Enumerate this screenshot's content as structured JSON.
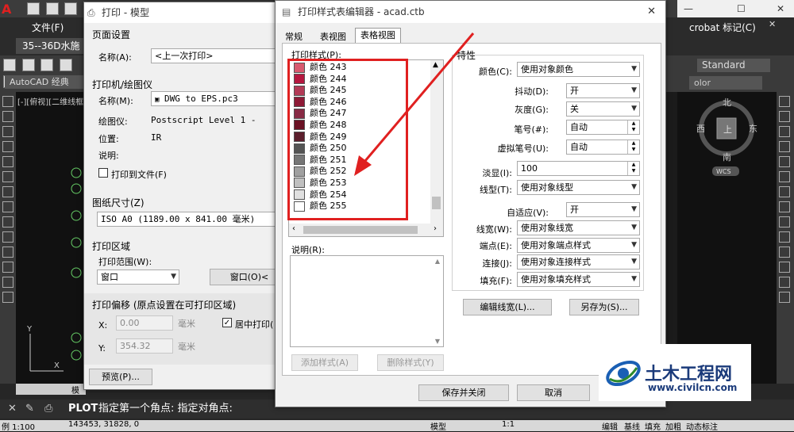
{
  "cad": {
    "tabs": {
      "file": "文件(F)",
      "drawing": "35--36D水施",
      "acrobat": "crobat 标记(C)"
    },
    "workspace": "AutoCAD 经典",
    "style_combo": "Standard",
    "color_combo": "olor",
    "viewport_label": "[-][俯视][二维线框",
    "compass": {
      "north": "北",
      "south": "南",
      "west": "西",
      "east": "东",
      "center": "上",
      "wcs": "WCS"
    },
    "command": {
      "prompt_label": "PLOT",
      "prompt_text": "指定第一个角点: 指定对角点:"
    },
    "status": {
      "scale": "例 1:100",
      "coords": "143453, 31828, 0",
      "model": "模型",
      "ratio": "1:1",
      "edit": "编辑",
      "baseline": "基线",
      "fill": "填充",
      "bold": "加粗",
      "dyn": "动态标注"
    },
    "model_tab": "模"
  },
  "plot_dialog": {
    "title": "打印 - 模型",
    "page_setup": {
      "heading": "页面设置",
      "name_label": "名称(A):",
      "name_value": "<上一次打印>"
    },
    "printer": {
      "heading": "打印机/绘图仪",
      "name_label": "名称(M):",
      "name_value": "DWG to EPS.pc3",
      "plotter_label": "绘图仪:",
      "plotter_value": "Postscript Level 1 -",
      "location_label": "位置:",
      "location_value": "IR",
      "desc_label": "说明:",
      "print_to_file": "打印到文件(F)"
    },
    "paper": {
      "heading": "图纸尺寸(Z)",
      "value": "ISO A0 (1189.00 x 841.00 毫米)"
    },
    "area": {
      "heading": "打印区域",
      "range_label": "打印范围(W):",
      "range_value": "窗口",
      "window_button": "窗口(O)<"
    },
    "offset": {
      "heading": "打印偏移 (原点设置在可打印区域)",
      "x_label": "X:",
      "x_value": "0.00",
      "x_unit": "毫米",
      "y_label": "Y:",
      "y_value": "354.32",
      "y_unit": "毫米",
      "center": "居中打印("
    },
    "preview_button": "预览(P)..."
  },
  "style_editor": {
    "title": "打印样式表编辑器 - acad.ctb",
    "tabs": [
      "常规",
      "表视图",
      "表格视图"
    ],
    "styles_label": "打印样式(P):",
    "styles": [
      {
        "name": "颜色 243",
        "color": "#d85a6f"
      },
      {
        "name": "颜色 244",
        "color": "#b5173f"
      },
      {
        "name": "颜色 245",
        "color": "#b23a56"
      },
      {
        "name": "颜色 246",
        "color": "#8e1a36"
      },
      {
        "name": "颜色 247",
        "color": "#882a44"
      },
      {
        "name": "颜色 248",
        "color": "#6a1224"
      },
      {
        "name": "颜色 249",
        "color": "#5c1e2c"
      },
      {
        "name": "颜色 250",
        "color": "#545454"
      },
      {
        "name": "颜色 251",
        "color": "#767676"
      },
      {
        "name": "颜色 252",
        "color": "#a0a0a0"
      },
      {
        "name": "颜色 253",
        "color": "#c0c0c0"
      },
      {
        "name": "颜色 254",
        "color": "#e0e0e0"
      },
      {
        "name": "颜色 255",
        "color": "#ffffff"
      }
    ],
    "desc_label": "说明(R):",
    "add_style": "添加样式(A)",
    "delete_style": "删除样式(Y)",
    "properties": {
      "heading": "特性",
      "color_label": "颜色(C):",
      "color_value": "使用对象颜色",
      "dither_label": "抖动(D):",
      "dither_value": "开",
      "gray_label": "灰度(G):",
      "gray_value": "关",
      "pen_label": "笔号(#):",
      "pen_value": "自动",
      "vpen_label": "虚拟笔号(U):",
      "vpen_value": "自动",
      "screen_label": "淡显(I):",
      "screen_value": "100",
      "linetype_label": "线型(T):",
      "linetype_value": "使用对象线型",
      "adaptive_label": "自适应(V):",
      "adaptive_value": "开",
      "lineweight_label": "线宽(W):",
      "lineweight_value": "使用对象线宽",
      "endpoint_label": "端点(E):",
      "endpoint_value": "使用对象端点样式",
      "join_label": "连接(J):",
      "join_value": "使用对象连接样式",
      "fill_label": "填充(F):",
      "fill_value": "使用对象填充样式"
    },
    "edit_lineweight": "编辑线宽(L)...",
    "save_as": "另存为(S)...",
    "save_close": "保存并关闭",
    "cancel": "取消"
  },
  "watermark": {
    "brand": "土木工程网",
    "url": "www.civilcn.com"
  },
  "colors": {
    "annotation_red": "#e02020",
    "arrow_red": "#e02020",
    "brand_blue": "#1a5fb4"
  }
}
